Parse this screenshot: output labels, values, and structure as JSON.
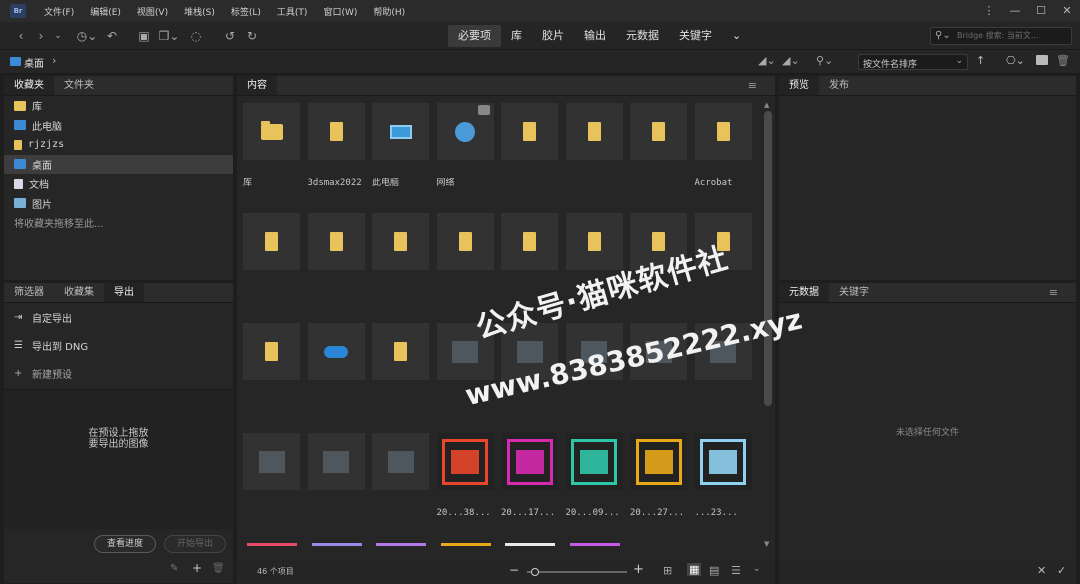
{
  "app": {
    "logo": "Br"
  },
  "menu": [
    "文件(F)",
    "编辑(E)",
    "视图(V)",
    "堆栈(S)",
    "标签(L)",
    "工具(T)",
    "窗口(W)",
    "帮助(H)"
  ],
  "window_controls": {
    "more": "⋮",
    "minimize": "—",
    "maximize": "☐",
    "close": "✕"
  },
  "workspaces": [
    "必要项",
    "库",
    "胶片",
    "输出",
    "元数据",
    "关键字"
  ],
  "workspaces_more": "⌄",
  "search": {
    "placeholder": "Bridge 搜索: 当前文..."
  },
  "path": {
    "current": "桌面",
    "sep": "›"
  },
  "sort": {
    "label": "按文件名排序"
  },
  "favorites_panel": {
    "tabs": [
      "收藏夹",
      "文件夹"
    ],
    "items": [
      {
        "label": "库",
        "icon": "library-icon"
      },
      {
        "label": "此电脑",
        "icon": "computer-icon"
      },
      {
        "label": "rjzjzs",
        "icon": "folder-icon"
      },
      {
        "label": "桌面",
        "icon": "desktop-icon"
      },
      {
        "label": "文档",
        "icon": "document-icon"
      },
      {
        "label": "图片",
        "icon": "pictures-icon"
      }
    ],
    "hint": "将收藏夹拖移至此..."
  },
  "export_panel": {
    "tabs": [
      "筛选器",
      "收藏集",
      "导出"
    ],
    "items": [
      {
        "label": "自定导出",
        "icon": "export-icon"
      },
      {
        "label": "导出到 DNG",
        "icon": "list-icon"
      },
      {
        "label": "新建预设",
        "icon": "plus-icon"
      }
    ],
    "drop_hint": "在预设上拖放\n要导出的图像",
    "view_progress": "查看进度",
    "start_export": "开始导出"
  },
  "content_panel": {
    "tab": "内容",
    "items": [
      {
        "label": "库",
        "type": "library"
      },
      {
        "label": "3dsmax2022",
        "type": "folder"
      },
      {
        "label": "此电脑",
        "type": "pc"
      },
      {
        "label": "网络",
        "type": "network"
      },
      {
        "label": "",
        "type": "folder"
      },
      {
        "label": "",
        "type": "folder"
      },
      {
        "label": "",
        "type": "folder"
      },
      {
        "label": "Acrobat",
        "type": "folder"
      },
      {
        "label": "",
        "type": "folder"
      },
      {
        "label": "",
        "type": "folder"
      },
      {
        "label": "",
        "type": "folder"
      },
      {
        "label": "",
        "type": "folder"
      },
      {
        "label": "",
        "type": "folder"
      },
      {
        "label": "",
        "type": "folder"
      },
      {
        "label": "",
        "type": "folder"
      },
      {
        "label": "",
        "type": "folder"
      },
      {
        "label": "",
        "type": "folder"
      },
      {
        "label": "",
        "type": "cloud"
      },
      {
        "label": "",
        "type": "folder"
      },
      {
        "label": "",
        "type": "blur"
      },
      {
        "label": "",
        "type": "blur"
      },
      {
        "label": "",
        "type": "blur"
      },
      {
        "label": "",
        "type": "blur"
      },
      {
        "label": "",
        "type": "blur"
      },
      {
        "label": "",
        "type": "blur"
      },
      {
        "label": "",
        "type": "blur"
      },
      {
        "label": "",
        "type": "blur"
      },
      {
        "label": "20...38...",
        "type": "adobe",
        "color": "#e8462a"
      },
      {
        "label": "20...17...",
        "type": "adobe",
        "color": "#d62ab0"
      },
      {
        "label": "20...09...",
        "type": "adobe",
        "color": "#2fc6a8"
      },
      {
        "label": "20...27...",
        "type": "adobe",
        "color": "#e8a81a"
      },
      {
        "label": "...23...",
        "type": "adobe",
        "color": "#8fd0f0"
      }
    ],
    "strip_colors": [
      "#e84a6a",
      "#9a8ae8",
      "#b07ae8",
      "#e8a81a",
      "#e8e8e8",
      "#c85ae8"
    ],
    "count": "46 个项目"
  },
  "preview_panel": {
    "tabs": [
      "预览",
      "发布"
    ]
  },
  "metadata_panel": {
    "tabs": [
      "元数据",
      "关键字"
    ],
    "empty": "未选择任何文件"
  },
  "watermark": {
    "line1": "公众号·猫咪软件社",
    "line2": "www.8383852222.xyz"
  },
  "colors": {
    "bg": "#1e1e1e",
    "panel": "#262626",
    "accent_folder": "#e8c25a",
    "accent_blue": "#3a8ad6"
  }
}
